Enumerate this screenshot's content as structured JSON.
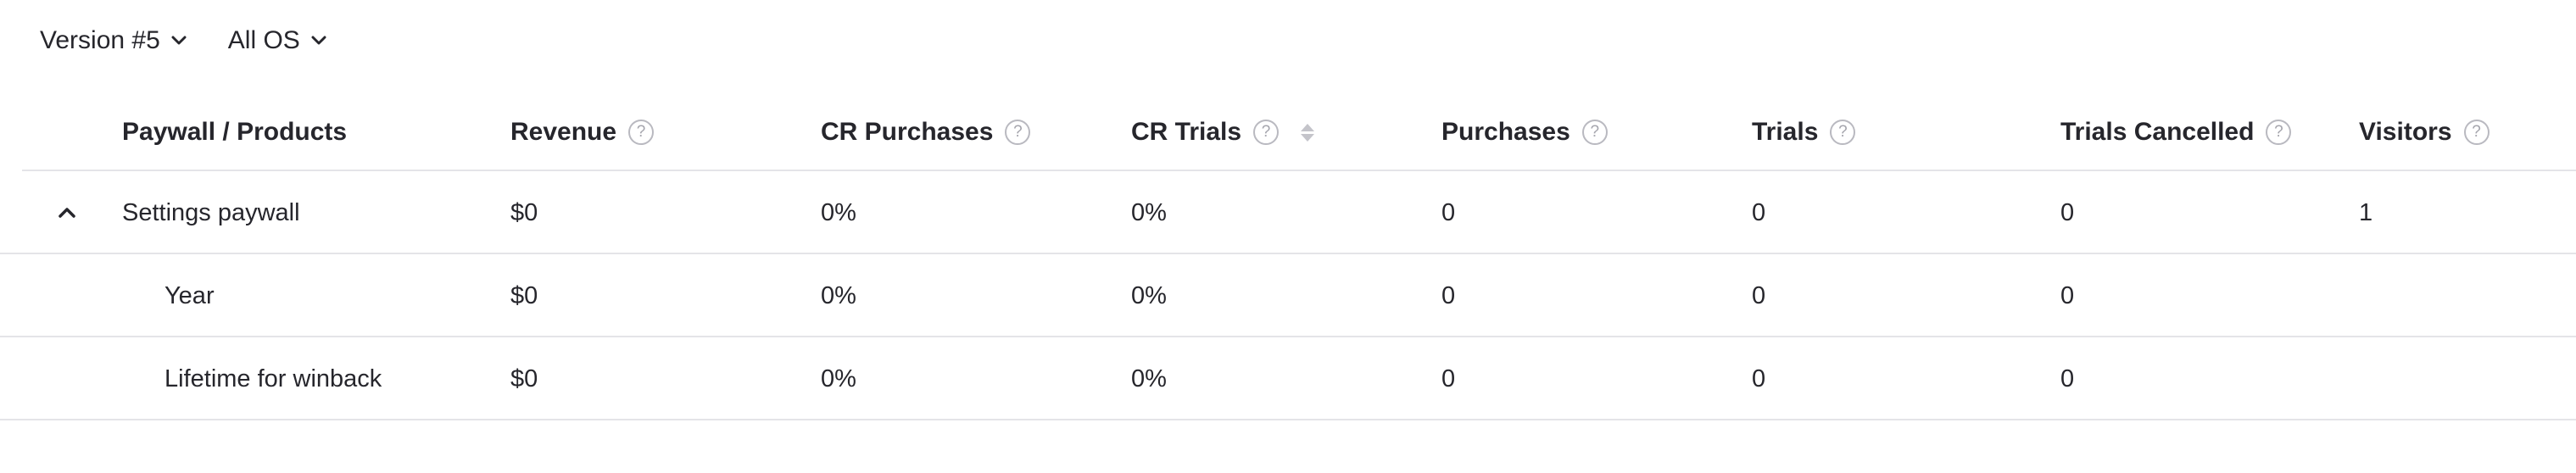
{
  "filters": {
    "version": "Version #5",
    "os": "All OS"
  },
  "columns": {
    "name": "Paywall / Products",
    "revenue": "Revenue",
    "cr_purchases": "CR Purchases",
    "cr_trials": "CR Trials",
    "purchases": "Purchases",
    "trials": "Trials",
    "trials_cancelled": "Trials Cancelled",
    "visitors": "Visitors",
    "help_glyph": "?"
  },
  "rows": [
    {
      "name": "Settings paywall",
      "revenue": "$0",
      "cr_purchases": "0%",
      "cr_trials": "0%",
      "purchases": "0",
      "trials": "0",
      "trials_cancelled": "0",
      "visitors": "1",
      "expanded": true
    },
    {
      "name": "Year",
      "revenue": "$0",
      "cr_purchases": "0%",
      "cr_trials": "0%",
      "purchases": "0",
      "trials": "0",
      "trials_cancelled": "0"
    },
    {
      "name": "Lifetime for winback",
      "revenue": "$0",
      "cr_purchases": "0%",
      "cr_trials": "0%",
      "purchases": "0",
      "trials": "0",
      "trials_cancelled": "0"
    }
  ],
  "icons": {
    "filter_chevron": "chevron-down-icon",
    "help": "help-circle-icon",
    "sort": "sort-icon",
    "collapse": "chevron-up-icon"
  },
  "colors": {
    "text": "#26262c",
    "border": "#e4e4e8",
    "icon_muted": "#b9b9c0"
  }
}
